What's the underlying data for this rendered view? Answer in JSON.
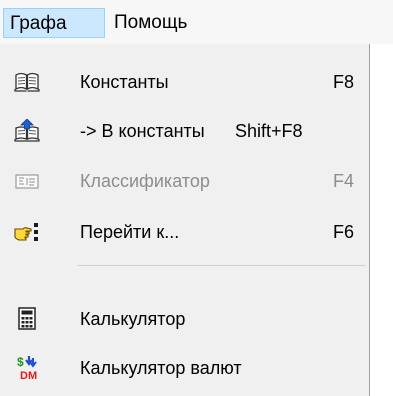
{
  "menubar": {
    "items": [
      {
        "label": "Графа"
      },
      {
        "label": "Помощь"
      }
    ]
  },
  "menu": {
    "items": [
      {
        "label": "Константы",
        "shortcut": "F8",
        "icon": "book-icon",
        "enabled": true
      },
      {
        "label": "-> В константы",
        "shortcut": "Shift+F8",
        "icon": "book-upload-icon",
        "enabled": true
      },
      {
        "label": "Классификатор",
        "shortcut": "F4",
        "icon": "classifier-icon",
        "enabled": false
      },
      {
        "label": "Перейти к...",
        "shortcut": "F6",
        "icon": "pointing-hand-icon",
        "enabled": true
      },
      {
        "label": "Калькулятор",
        "icon": "calculator-icon",
        "enabled": true
      },
      {
        "label": "Калькулятор валют",
        "icon": "currency-calculator-icon",
        "enabled": true
      }
    ],
    "icon_texts": {
      "currency_top": "$",
      "currency_bottom": "DM"
    }
  }
}
